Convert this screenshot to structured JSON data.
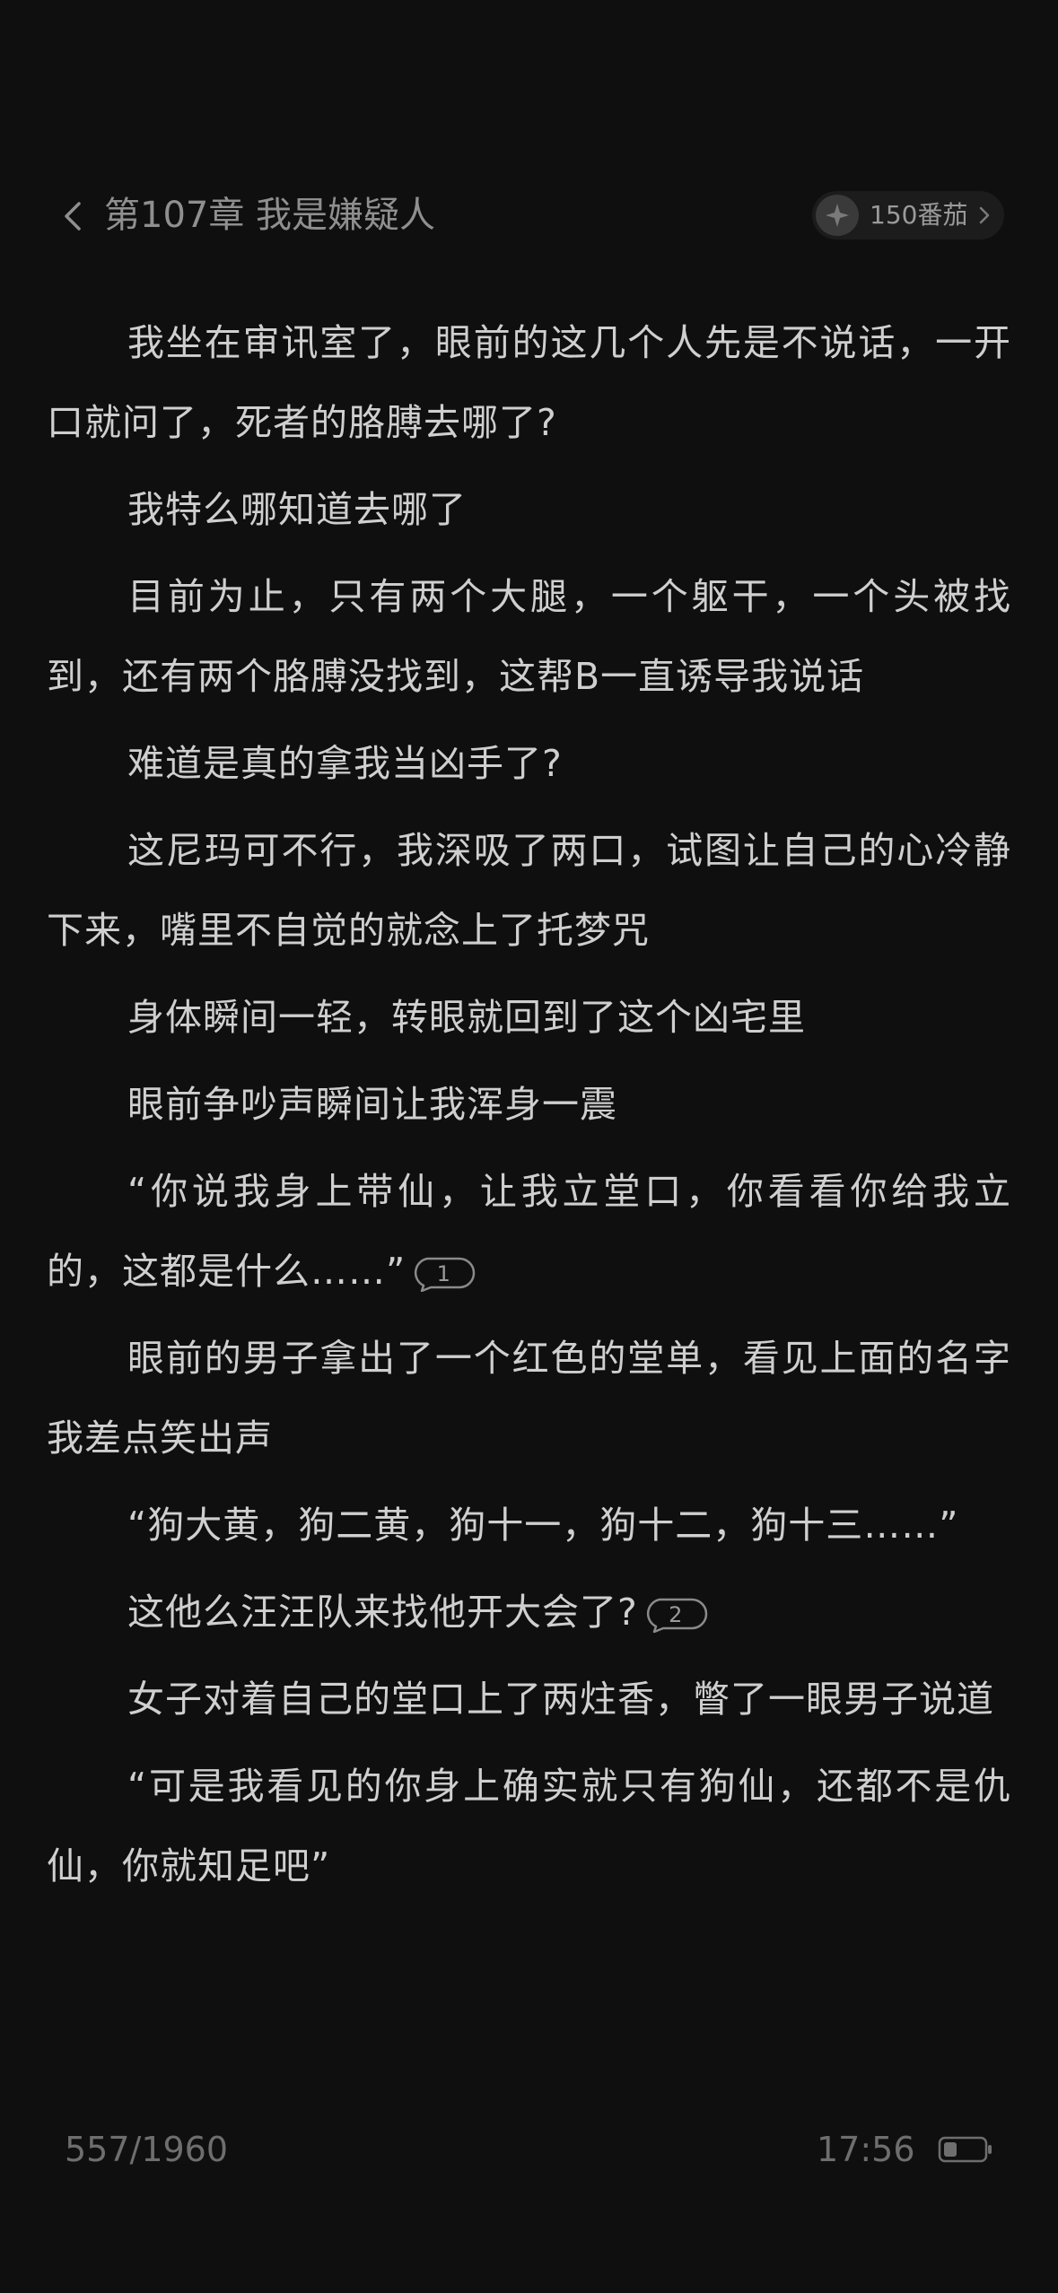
{
  "header": {
    "chapter_title": "第107章 我是嫌疑人",
    "coin_label": "150番茄",
    "back_icon": "chevron-left-icon",
    "coin_icon": "sparkle-coin-icon"
  },
  "paragraphs": [
    {
      "text": "我坐在审讯室了，眼前的这几个人先是不说话，一开口就问了，死者的胳膊去哪了?"
    },
    {
      "text": "我特么哪知道去哪了"
    },
    {
      "text": "目前为止，只有两个大腿，一个躯干，一个头被找到，还有两个胳膊没找到，这帮B一直诱导我说话"
    },
    {
      "text": "难道是真的拿我当凶手了?"
    },
    {
      "text": "这尼玛可不行，我深吸了两口，试图让自己的心冷静下来，嘴里不自觉的就念上了托梦咒"
    },
    {
      "text": "身体瞬间一轻，转眼就回到了这个凶宅里"
    },
    {
      "text": "眼前争吵声瞬间让我浑身一震"
    },
    {
      "text": "“你说我身上带仙，让我立堂口，你看看你给我立的，这都是什么……”",
      "comments": "1"
    },
    {
      "text": "眼前的男子拿出了一个红色的堂单，看见上面的名字我差点笑出声"
    },
    {
      "text": "“狗大黄，狗二黄，狗十一，狗十二，狗十三……”"
    },
    {
      "text": "这他么汪汪队来找他开大会了?",
      "comments": "2"
    },
    {
      "text": "女子对着自己的堂口上了两炷香，瞥了一眼男子说道"
    },
    {
      "text": "“可是我看见的你身上确实就只有狗仙，还都不是仇仙，你就知足吧”"
    }
  ],
  "footer": {
    "progress": "557/1960",
    "time": "17:56",
    "battery_icon": "battery-low-icon"
  },
  "colors": {
    "background": "#0f0f0f",
    "text": "#cfcfcf",
    "muted": "#8f8f8f"
  }
}
